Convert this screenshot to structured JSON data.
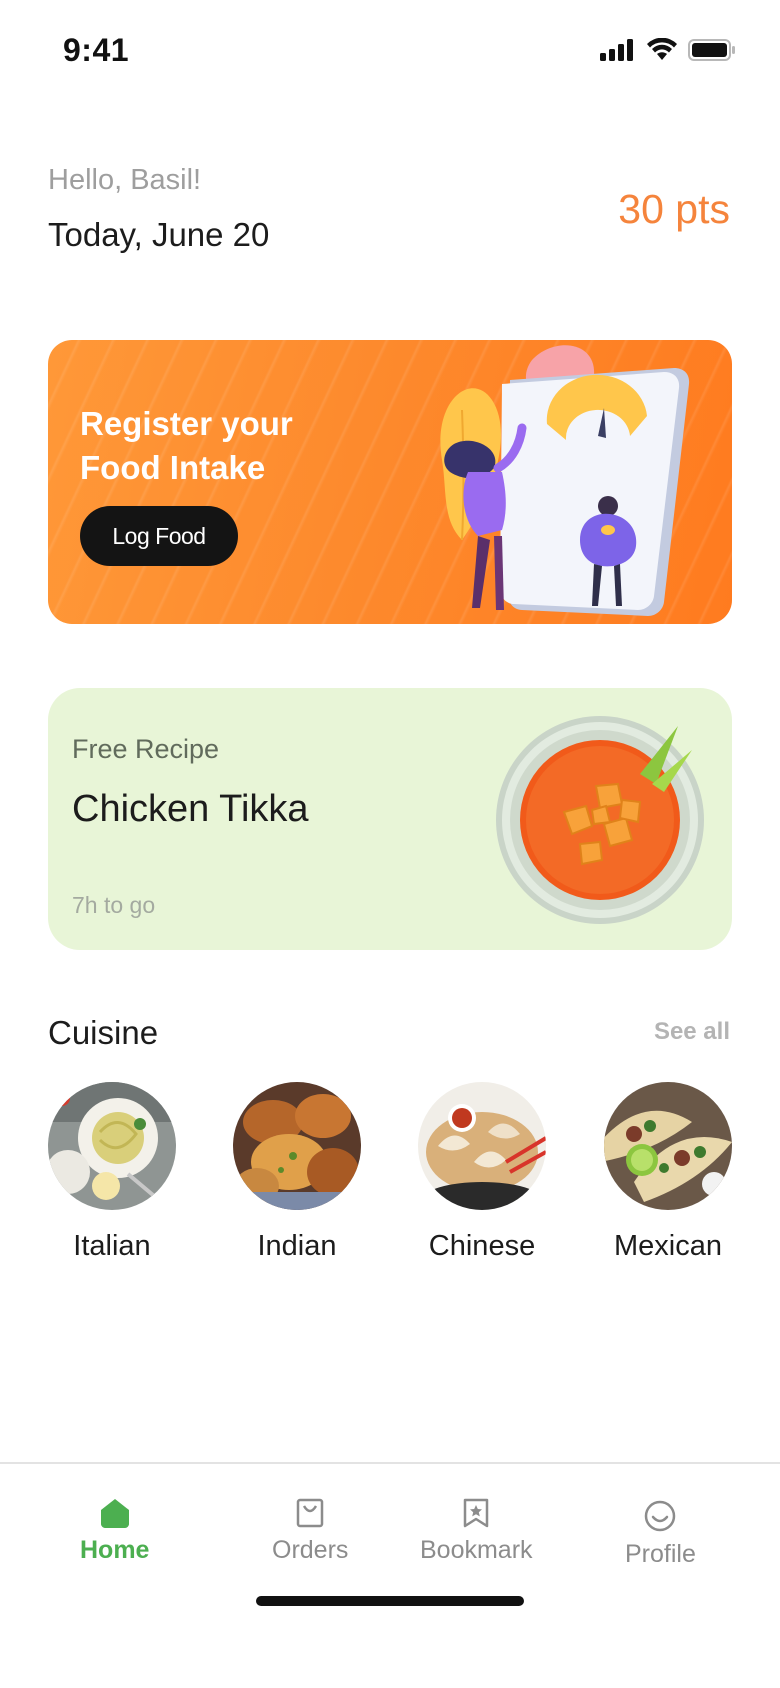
{
  "status_bar": {
    "time": "9:41",
    "icons": [
      "cellular-signal-icon",
      "wifi-icon",
      "battery-icon"
    ]
  },
  "header": {
    "greeting": "Hello, Basil!",
    "date": "Today, June 20",
    "points": "30 pts"
  },
  "banner": {
    "title": "Register your Food Intake",
    "button_label": "Log Food",
    "illustration": "weight-scale-illustration"
  },
  "recipe_card": {
    "tag": "Free Recipe",
    "name": "Chicken Tikka",
    "time_left": "7h to go",
    "image": "curry-bowl-illustration"
  },
  "cuisine": {
    "title": "Cuisine",
    "see_all_label": "See all",
    "items": [
      {
        "label": "Italian",
        "image": "pasta-photo"
      },
      {
        "label": "Indian",
        "image": "fried-pakora-photo"
      },
      {
        "label": "Chinese",
        "image": "dumplings-photo"
      },
      {
        "label": "Mexican",
        "image": "tacos-photo"
      }
    ]
  },
  "bottom_nav": {
    "items": [
      {
        "label": "Home",
        "icon": "home-icon",
        "active": true
      },
      {
        "label": "Orders",
        "icon": "shopping-bag-icon",
        "active": false
      },
      {
        "label": "Bookmark",
        "icon": "bookmark-icon",
        "active": false
      },
      {
        "label": "Profile",
        "icon": "smiley-face-icon",
        "active": false
      }
    ]
  },
  "colors": {
    "accent_orange": "#f5843c",
    "banner_orange": "#fd8a2d",
    "recipe_green_bg": "#e8f5d7",
    "active_nav_green": "#4caf50",
    "button_dark": "#141414"
  }
}
